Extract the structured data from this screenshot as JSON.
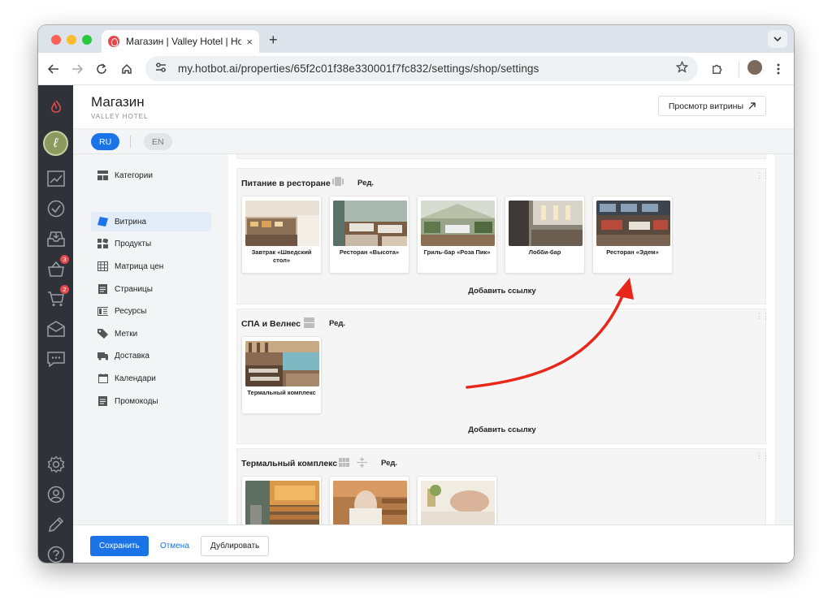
{
  "browser": {
    "tab_title": "Магазин | Valley Hotel | Hotbo",
    "tab_close": "×",
    "new_tab": "+",
    "url": "my.hotbot.ai/properties/65f2c01f38e330001f7fc832/settings/shop/settings"
  },
  "header": {
    "title": "Магазин",
    "subtitle": "VALLEY HOTEL",
    "preview_button": "Просмотр витрины"
  },
  "languages": [
    "RU",
    "EN"
  ],
  "rail": {
    "badges": {
      "orders": "3",
      "cart": "2"
    }
  },
  "sidenav": {
    "items": [
      {
        "label": "Категории",
        "icon": "categories-icon"
      },
      {
        "label": "Витрина",
        "icon": "showcase-icon",
        "active": true
      },
      {
        "label": "Продукты",
        "icon": "products-icon"
      },
      {
        "label": "Матрица цен",
        "icon": "price-matrix-icon"
      },
      {
        "label": "Страницы",
        "icon": "pages-icon"
      },
      {
        "label": "Ресурсы",
        "icon": "resources-icon"
      },
      {
        "label": "Метки",
        "icon": "tags-icon"
      },
      {
        "label": "Доставка",
        "icon": "delivery-icon"
      },
      {
        "label": "Календари",
        "icon": "calendar-icon"
      },
      {
        "label": "Промокоды",
        "icon": "promo-icon"
      }
    ]
  },
  "sections": [
    {
      "title": "Питание в ресторане",
      "edit": "Ред.",
      "add_link": "Добавить ссылку",
      "cards": [
        {
          "label": "Завтрак «Шведский стол»"
        },
        {
          "label": "Ресторан «Высота»"
        },
        {
          "label": "Гриль-бар «Роза Пик»"
        },
        {
          "label": "Лобби-бар"
        },
        {
          "label": "Ресторан «Эдем»"
        }
      ]
    },
    {
      "title": "СПА и Велнес",
      "edit": "Ред.",
      "add_link": "Добавить ссылку",
      "cards": [
        {
          "label": "Термальный комплекс"
        }
      ]
    },
    {
      "title": "Термальный комплекс",
      "edit": "Ред.",
      "cards": [
        {
          "label": ""
        },
        {
          "label": ""
        },
        {
          "label": ""
        }
      ]
    }
  ],
  "footer": {
    "save": "Сохранить",
    "cancel": "Отмена",
    "duplicate": "Дублировать"
  },
  "colors": {
    "accent": "#1b73e8",
    "rail": "#2f3239",
    "annotation_arrow": "#e8261a"
  }
}
